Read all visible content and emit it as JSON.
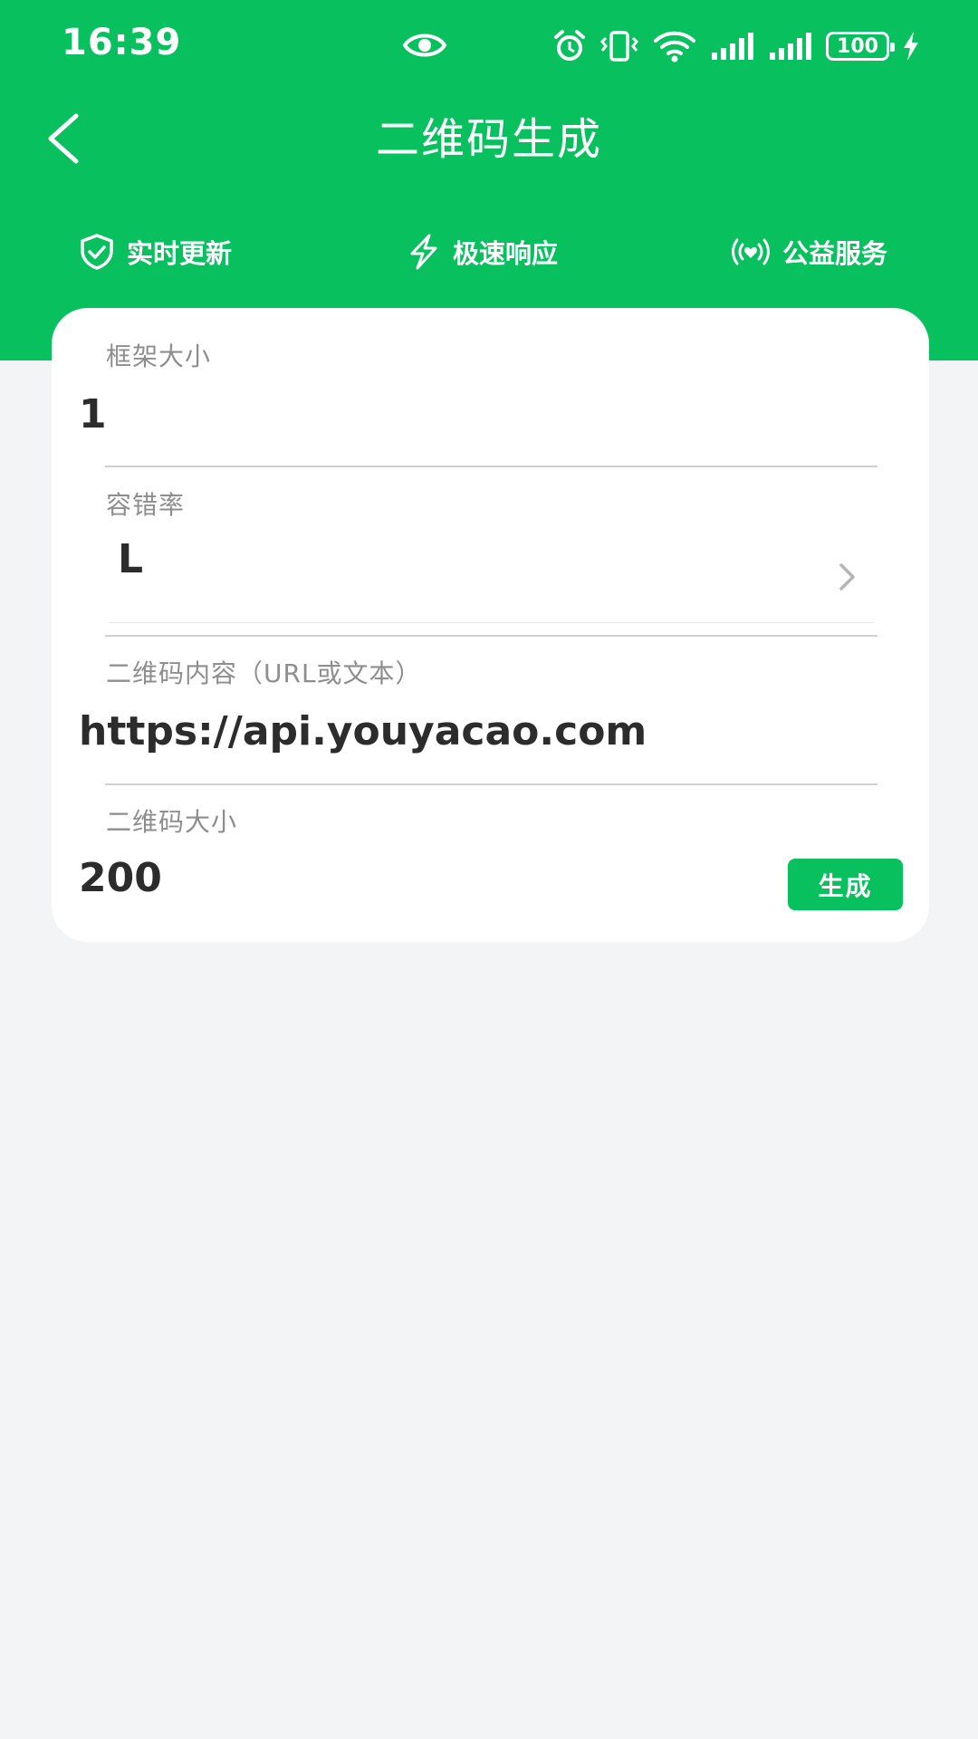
{
  "status_bar": {
    "time": "16:39",
    "battery": "100",
    "icons": [
      "eye-icon",
      "alarm-icon",
      "vibrate-icon",
      "wifi-icon",
      "signal-icon",
      "signal-icon",
      "battery-icon",
      "charging-icon"
    ]
  },
  "header": {
    "title": "二维码生成",
    "back_icon": "chevron-left-icon"
  },
  "features": [
    {
      "label": "实时更新",
      "icon": "shield-check-icon"
    },
    {
      "label": "极速响应",
      "icon": "lightning-icon"
    },
    {
      "label": "公益服务",
      "icon": "heart-broadcast-icon"
    }
  ],
  "form": {
    "frame_size": {
      "label": "框架大小",
      "value": "1"
    },
    "error_correction": {
      "label": "容错率",
      "value": "L"
    },
    "content": {
      "label": "二维码内容（URL或文本）",
      "value": "https://api.youyacao.com"
    },
    "qr_size": {
      "label": "二维码大小",
      "value": "200"
    },
    "generate_label": "生成"
  },
  "colors": {
    "accent": "#08c15e",
    "background": "#f3f4f6",
    "card": "#ffffff"
  }
}
